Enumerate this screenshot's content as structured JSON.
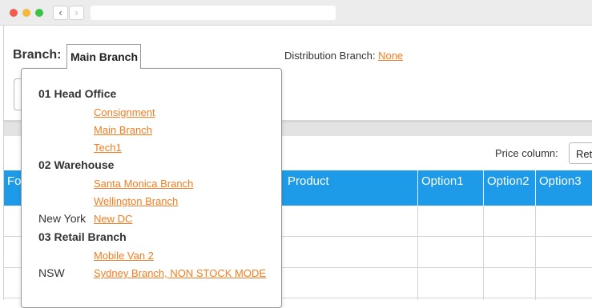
{
  "browser": {
    "back_glyph": "‹",
    "forward_glyph": "›"
  },
  "header": {
    "branch_label": "Branch:",
    "branch_value": "Main Branch",
    "distribution_label": "Distribution Branch:",
    "distribution_value": "None"
  },
  "price": {
    "label": "Price column:",
    "value": "Ret"
  },
  "table": {
    "columns": [
      "Fo",
      "Product",
      "Option1",
      "Option2",
      "Option3"
    ]
  },
  "dropdown": {
    "groups": [
      {
        "label": "01 Head Office",
        "items": [
          "Consignment",
          "Main Branch",
          "Tech1"
        ]
      },
      {
        "label": "02 Warehouse",
        "items": [
          "Santa Monica Branch",
          "Wellington Branch"
        ]
      },
      {
        "sublabel": "New York",
        "items": [
          "New DC"
        ]
      },
      {
        "label": "03 Retail Branch",
        "items": [
          "Mobile Van 2"
        ]
      },
      {
        "sublabel": "NSW",
        "items": [
          "Sydney Branch, NON STOCK MODE"
        ]
      }
    ]
  },
  "colors": {
    "accent_link": "#f47c20",
    "table_header": "#1e9be8"
  }
}
